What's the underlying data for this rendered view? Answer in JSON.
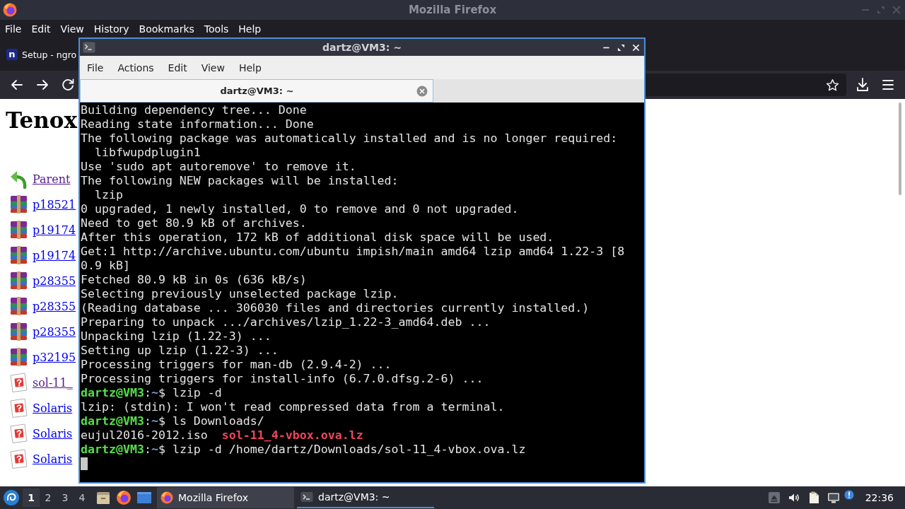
{
  "firefox": {
    "title": "Mozilla Firefox",
    "menu": [
      "File",
      "Edit",
      "View",
      "History",
      "Bookmarks",
      "Tools",
      "Help"
    ],
    "tabs": [
      {
        "label": "Setup - ngro",
        "favicon": "n"
      }
    ],
    "page": {
      "heading": "Tenox",
      "entries": [
        {
          "kind": "parent",
          "label": "Parent",
          "visited": true
        },
        {
          "kind": "archive",
          "label": "p18521",
          "visited": false
        },
        {
          "kind": "archive",
          "label": "p19174",
          "visited": false
        },
        {
          "kind": "archive",
          "label": "p19174",
          "visited": false
        },
        {
          "kind": "archive",
          "label": "p28355",
          "visited": false
        },
        {
          "kind": "archive",
          "label": "p28355",
          "visited": false
        },
        {
          "kind": "archive",
          "label": "p28355",
          "visited": false
        },
        {
          "kind": "archive",
          "label": "p32195",
          "visited": false
        },
        {
          "kind": "unknown",
          "label": "sol-11_",
          "visited": true
        },
        {
          "kind": "unknown",
          "label": "Solaris",
          "visited": false
        },
        {
          "kind": "unknown",
          "label": "Solaris",
          "visited": false
        },
        {
          "kind": "unknown",
          "label": "Solaris",
          "visited": false
        }
      ]
    }
  },
  "terminal": {
    "title": "dartz@VM3: ~",
    "menu": [
      "File",
      "Actions",
      "Edit",
      "View",
      "Help"
    ],
    "tabs": [
      {
        "label": "dartz@VM3: ~",
        "selected": true
      }
    ],
    "lines": [
      {
        "segments": [
          {
            "kind": "plain",
            "text": "Building dependency tree... Done"
          }
        ]
      },
      {
        "segments": [
          {
            "kind": "plain",
            "text": "Reading state information... Done"
          }
        ]
      },
      {
        "segments": [
          {
            "kind": "plain",
            "text": "The following package was automatically installed and is no longer required:"
          }
        ]
      },
      {
        "segments": [
          {
            "kind": "plain",
            "text": "  libfwupdplugin1"
          }
        ]
      },
      {
        "segments": [
          {
            "kind": "plain",
            "text": "Use 'sudo apt autoremove' to remove it."
          }
        ]
      },
      {
        "segments": [
          {
            "kind": "plain",
            "text": "The following NEW packages will be installed:"
          }
        ]
      },
      {
        "segments": [
          {
            "kind": "plain",
            "text": "  lzip"
          }
        ]
      },
      {
        "segments": [
          {
            "kind": "plain",
            "text": "0 upgraded, 1 newly installed, 0 to remove and 0 not upgraded."
          }
        ]
      },
      {
        "segments": [
          {
            "kind": "plain",
            "text": "Need to get 80.9 kB of archives."
          }
        ]
      },
      {
        "segments": [
          {
            "kind": "plain",
            "text": "After this operation, 172 kB of additional disk space will be used."
          }
        ]
      },
      {
        "segments": [
          {
            "kind": "plain",
            "text": "Get:1 http://archive.ubuntu.com/ubuntu impish/main amd64 lzip amd64 1.22-3 [8"
          }
        ]
      },
      {
        "segments": [
          {
            "kind": "plain",
            "text": "0.9 kB]"
          }
        ]
      },
      {
        "segments": [
          {
            "kind": "plain",
            "text": "Fetched 80.9 kB in 0s (636 kB/s)"
          }
        ]
      },
      {
        "segments": [
          {
            "kind": "plain",
            "text": "Selecting previously unselected package lzip."
          }
        ]
      },
      {
        "segments": [
          {
            "kind": "plain",
            "text": "(Reading database ... 306030 files and directories currently installed.)"
          }
        ]
      },
      {
        "segments": [
          {
            "kind": "plain",
            "text": "Preparing to unpack .../archives/lzip_1.22-3_amd64.deb ..."
          }
        ]
      },
      {
        "segments": [
          {
            "kind": "plain",
            "text": "Unpacking lzip (1.22-3) ..."
          }
        ]
      },
      {
        "segments": [
          {
            "kind": "plain",
            "text": "Setting up lzip (1.22-3) ..."
          }
        ]
      },
      {
        "segments": [
          {
            "kind": "plain",
            "text": "Processing triggers for man-db (2.9.4-2) ..."
          }
        ]
      },
      {
        "segments": [
          {
            "kind": "plain",
            "text": "Processing triggers for install-info (6.7.0.dfsg.2-6) ..."
          }
        ]
      },
      {
        "segments": [
          {
            "kind": "user",
            "text": "dartz@VM3"
          },
          {
            "kind": "plain",
            "text": ":"
          },
          {
            "kind": "path",
            "text": "~"
          },
          {
            "kind": "plain",
            "text": "$ lzip -d"
          }
        ]
      },
      {
        "segments": [
          {
            "kind": "plain",
            "text": "lzip: (stdin): I won't read compressed data from a terminal."
          }
        ]
      },
      {
        "segments": [
          {
            "kind": "user",
            "text": "dartz@VM3"
          },
          {
            "kind": "plain",
            "text": ":"
          },
          {
            "kind": "path",
            "text": "~"
          },
          {
            "kind": "plain",
            "text": "$ ls Downloads/"
          }
        ]
      },
      {
        "segments": [
          {
            "kind": "plain",
            "text": "eujul2016-2012.iso  "
          },
          {
            "kind": "archive",
            "text": "sol-11_4-vbox.ova.lz"
          }
        ]
      },
      {
        "segments": [
          {
            "kind": "user",
            "text": "dartz@VM3"
          },
          {
            "kind": "plain",
            "text": ":"
          },
          {
            "kind": "path",
            "text": "~"
          },
          {
            "kind": "plain",
            "text": "$ lzip -d /home/dartz/Downloads/sol-11_4-vbox.ova.lz"
          }
        ]
      }
    ],
    "cursor": true
  },
  "taskbar": {
    "workspaces": [
      {
        "label": "1",
        "selected": true
      },
      {
        "label": "2",
        "selected": false
      },
      {
        "label": "3",
        "selected": false
      },
      {
        "label": "4",
        "selected": false
      }
    ],
    "tasks": [
      {
        "kind": "firefox",
        "label": "Mozilla Firefox",
        "selected": false
      },
      {
        "kind": "terminal",
        "label": "dartz@VM3: ~",
        "selected": true
      }
    ],
    "clock": "22:36"
  }
}
